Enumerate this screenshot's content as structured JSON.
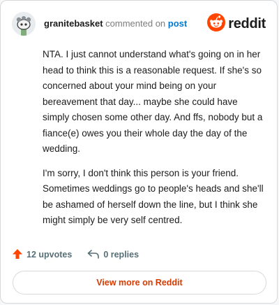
{
  "header": {
    "username": "granitebasket",
    "action_text": "commented on",
    "target_link": "post",
    "logo_text": "reddit"
  },
  "comment": {
    "paragraphs": [
      "NTA. I just cannot understand what's going on in her head to think this is a reasonable request. If she's so concerned about your mind being on your bereavement that day... maybe she could have simply chosen some other day. And ffs, nobody but a fiance(e) owes you their whole day the day of the wedding.",
      "I'm sorry, I don't think this person is your friend. Sometimes weddings go to people's heads and she'll be ashamed of herself down the line, but I think she might simply be very self centred."
    ]
  },
  "actions": {
    "upvotes_label": "12 upvotes",
    "replies_label": "0 replies"
  },
  "footer": {
    "view_more_label": "View more on Reddit"
  },
  "colors": {
    "brand": "#ff4500",
    "link": "#0079d3",
    "cta": "#d93a00"
  },
  "icons": [
    "snoo-avatar-icon",
    "reddit-logo-icon",
    "upvote-arrow-icon",
    "reply-arrow-icon"
  ]
}
